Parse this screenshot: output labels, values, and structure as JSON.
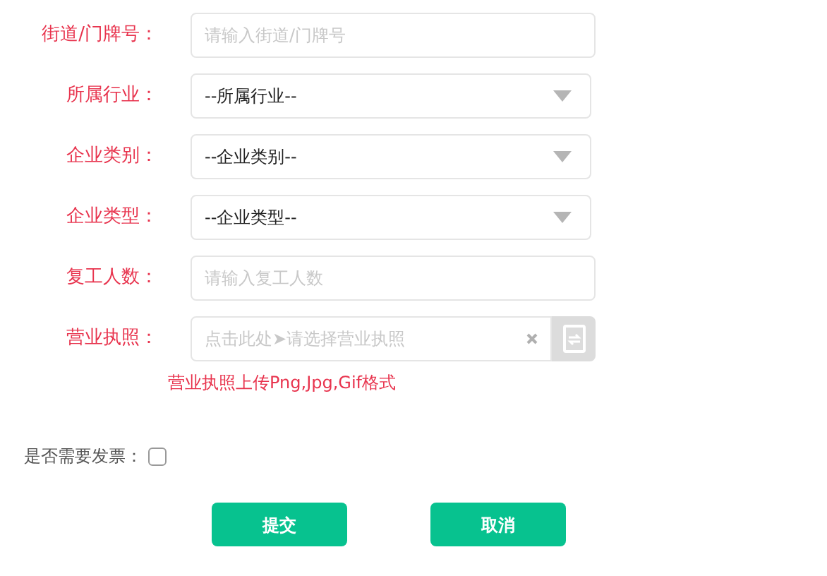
{
  "fields": [
    {
      "kind": "text",
      "label": "街道/门牌号：",
      "placeholder": "请输入街道/门牌号"
    },
    {
      "kind": "select",
      "label": "所属行业：",
      "value": "--所属行业--"
    },
    {
      "kind": "select",
      "label": "企业类别：",
      "value": "--企业类别--"
    },
    {
      "kind": "select",
      "label": "企业类型：",
      "value": "--企业类型--"
    },
    {
      "kind": "text",
      "label": "复工人数：",
      "placeholder": "请输入复工人数"
    },
    {
      "kind": "file",
      "label": "营业执照：",
      "placeholder": "点击此处➤请选择营业执照"
    }
  ],
  "upload_hint": "营业执照上传Png,Jpg,Gif格式",
  "invoice": {
    "label": "是否需要发票：",
    "checked": false
  },
  "buttons": [
    "提交",
    "取消"
  ]
}
